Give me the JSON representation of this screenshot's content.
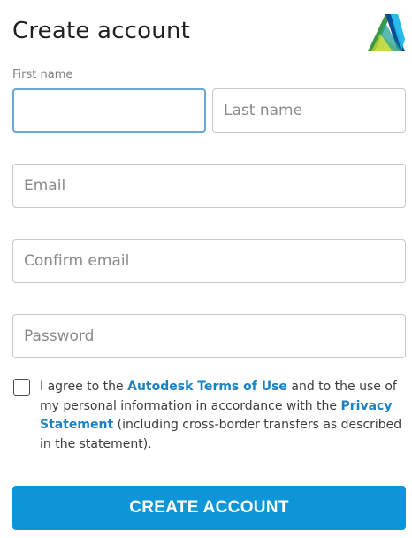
{
  "header": {
    "title": "Create account"
  },
  "brand": {
    "logo_icon": "autodesk-logo",
    "colors": [
      "#1bb7ea",
      "#0e4d96",
      "#3b9648",
      "#b8d430"
    ]
  },
  "form": {
    "first_name": {
      "label": "First name",
      "value": "",
      "placeholder": ""
    },
    "last_name": {
      "placeholder": "Last name",
      "value": ""
    },
    "email": {
      "placeholder": "Email",
      "value": ""
    },
    "confirm_email": {
      "placeholder": "Confirm email",
      "value": ""
    },
    "password": {
      "placeholder": "Password",
      "value": ""
    }
  },
  "consent": {
    "checked": false,
    "text_before": "I agree to the ",
    "terms_link": "Autodesk Terms of Use",
    "text_middle": " and to the use of my personal information in accordance with the ",
    "privacy_link": "Privacy Statement",
    "text_after": " (including cross-border transfers as described in the statement)."
  },
  "actions": {
    "submit_label": "CREATE ACCOUNT"
  },
  "colors": {
    "accent": "#0c96d8",
    "link": "#1a82c4",
    "focus_border": "#6aa6d6"
  }
}
